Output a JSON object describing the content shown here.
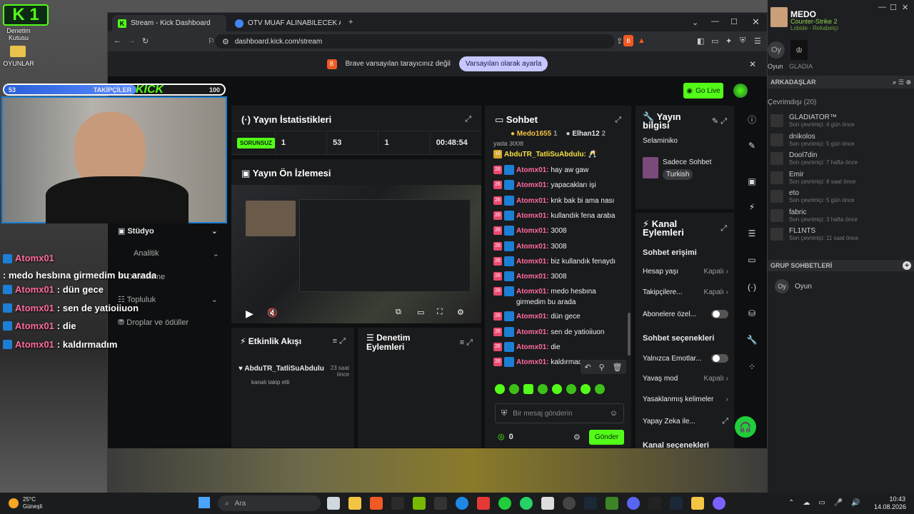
{
  "desktop": {
    "k1_label": "K 1",
    "icon1_label": "Denetim Kutusu",
    "icon2_label": "OYUNLAR"
  },
  "browser": {
    "tab1": "Stream - Kick Dashboard",
    "tab2": "OTV MUAF ALINABILECEK ARABALAR",
    "url": "dashboard.kick.com/stream",
    "infobar_text": "Brave varsayılan tarayıcınız değil",
    "infobar_button": "Varsayılan olarak ayarla"
  },
  "kick": {
    "go_live": "Go Live",
    "stats": {
      "title": "Yayın İstatistikleri",
      "status": "SORUNSUZ",
      "values": [
        "1",
        "53",
        "1",
        "00:48:54"
      ]
    },
    "preview_title": "Yayın Ön İzlemesi",
    "nav": [
      {
        "label": "Stüdyo"
      },
      {
        "label": "Analitik"
      },
      {
        "label": "Denetleme"
      },
      {
        "label": "Topluluk"
      },
      {
        "label": "Droplar ve ödüller"
      }
    ],
    "activity": {
      "title": "Etkinlik Akışı",
      "user": "AbduTR_TatliSuAbdulu",
      "time": "23 saat önce",
      "action": "kanalı takip etti"
    },
    "moderation_title": "Denetim Eylemleri",
    "chat": {
      "title": "Sohbet",
      "top_users": [
        "Medo1655",
        "Elhan12"
      ],
      "top_ranks": [
        "1",
        "2"
      ],
      "first_line": "yada 3008",
      "abdu_level": "10",
      "abdu_name": "AbduTR_TatliSuAbdulu:",
      "level": "26",
      "messages": [
        {
          "user": "Atomx01:",
          "text": "hay aw gaw"
        },
        {
          "user": "Atomx01:",
          "text": "yapacakları işi"
        },
        {
          "user": "Atomx01:",
          "text": "knk bak bi ama nası"
        },
        {
          "user": "Atomx01:",
          "text": "kullandık fena araba"
        },
        {
          "user": "Atomx01:",
          "text": "3008"
        },
        {
          "user": "Atomx01:",
          "text": "3008"
        },
        {
          "user": "Atomx01:",
          "text": "biz kullandık fenaydı"
        },
        {
          "user": "Atomx01:",
          "text": "3008"
        },
        {
          "user": "Atomx01:",
          "text": "medo hesbına girmedim bu arada"
        },
        {
          "user": "Atomx01:",
          "text": "dün gece"
        },
        {
          "user": "Atomx01:",
          "text": "sen de yatioiiuon"
        },
        {
          "user": "Atomx01:",
          "text": "die"
        },
        {
          "user": "Atomx01:",
          "text": "kaldırmadım"
        }
      ],
      "placeholder": "Bir mesaj gönderin",
      "points": "0",
      "send": "Gönder"
    },
    "info": {
      "title": "Yayın bilgisi",
      "stream_title": "Selaminiko",
      "category": "Sadece Sohbet",
      "language": "Turkish"
    },
    "channel": {
      "title": "Kanal Eylemleri",
      "chat_access": "Sohbet erişimi",
      "rows": [
        {
          "label": "Hesap yaşı",
          "value": "Kapalı"
        },
        {
          "label": "Takipçilere...",
          "value": "Kapalı"
        },
        {
          "label": "Abonelere özel..."
        }
      ],
      "chat_options": "Sohbet seçenekleri",
      "rows2": [
        {
          "label": "Yalnızca Emotlar..."
        },
        {
          "label": "Yavaş mod",
          "value": "Kapalı"
        },
        {
          "label": "Yasaklanmış kelimeler"
        },
        {
          "label": "Yapay Zeka ile..."
        }
      ],
      "channel_options": "Kanal seçenekleri"
    }
  },
  "overlay": {
    "followers_left": "53",
    "followers_label": "TAKİPÇİLER",
    "followers_right": "100",
    "chat": [
      {
        "user": "Atomx01",
        "text": ": medo hesbına girmedim bu arada"
      },
      {
        "user": "Atomx01",
        "text": ": dün gece"
      },
      {
        "user": "Atomx01",
        "text": ": sen de yatioiiuon"
      },
      {
        "user": "Atomx01",
        "text": ": die"
      },
      {
        "user": "Atomx01",
        "text": ": kaldırmadım"
      }
    ]
  },
  "steam": {
    "user": "MEDO",
    "game": "Counter-Strike 2",
    "sub": "Lobide - Rekabetçi",
    "tab1": "Oyun",
    "tab2": "GLADIA",
    "friends_header": "ARKADAŞLAR",
    "online_label": "Çevrimdışı",
    "online_count": "(20)",
    "friends": [
      {
        "name": "GLADIATOR™",
        "sub": "Son çevrimiçi: 4 gün önce"
      },
      {
        "name": "dnikolos",
        "sub": "Son çevrimiçi: 5 gün önce"
      },
      {
        "name": "Dool7din",
        "sub": "Son çevrimiçi: 7 hafta önce"
      },
      {
        "name": "Emir",
        "sub": "Son çevrimiçi: 8 saat önce"
      },
      {
        "name": "eto",
        "sub": "Son çevrimiçi: 5 gün önce"
      },
      {
        "name": "fabric",
        "sub": "Son çevrimiçi: 3 hafta önce"
      },
      {
        "name": "FL1NTS",
        "sub": "Son çevrimiçi: 11 saat önce"
      }
    ],
    "group_header": "GRUP SOHBETLERİ",
    "group": "Oyun"
  },
  "taskbar": {
    "weather_temp": "25°C",
    "weather_desc": "Güneşli",
    "search": "Ara",
    "time": "10:43",
    "date": "14.08.2026"
  }
}
